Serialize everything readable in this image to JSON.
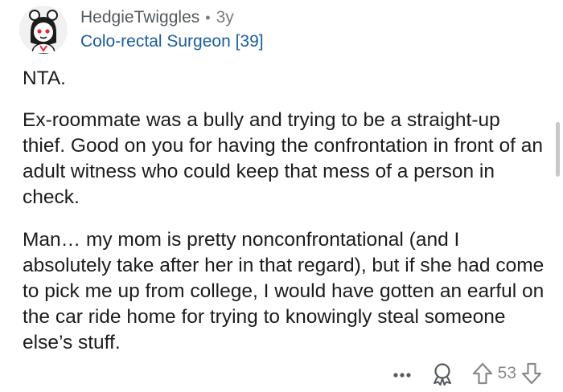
{
  "comment": {
    "author": "HedgieTwiggles",
    "separator": "•",
    "age": "3y",
    "flair": "Colo-rectal Surgeon [39]",
    "paragraphs": [
      "NTA.",
      "Ex-roommate was a bully and trying to be a straight-up thief. Good on you for having the confrontation in front of an adult witness who could keep that mess of a person in check.",
      "Man… my mom is pretty nonconfrontational (and I absolutely take after her in that regard), but if she had come to pick me up from college, I would have gotten an earful on the car ride home for trying to knowingly steal someone else’s stuff."
    ],
    "score": "53"
  },
  "icons": {
    "more": "more-dots-icon",
    "award": "award-icon",
    "upvote": "upvote-arrow-icon",
    "downvote": "downvote-arrow-icon"
  },
  "colors": {
    "flair": "#1a5d9c",
    "text": "#1c1c1c",
    "muted": "#878a8c"
  }
}
